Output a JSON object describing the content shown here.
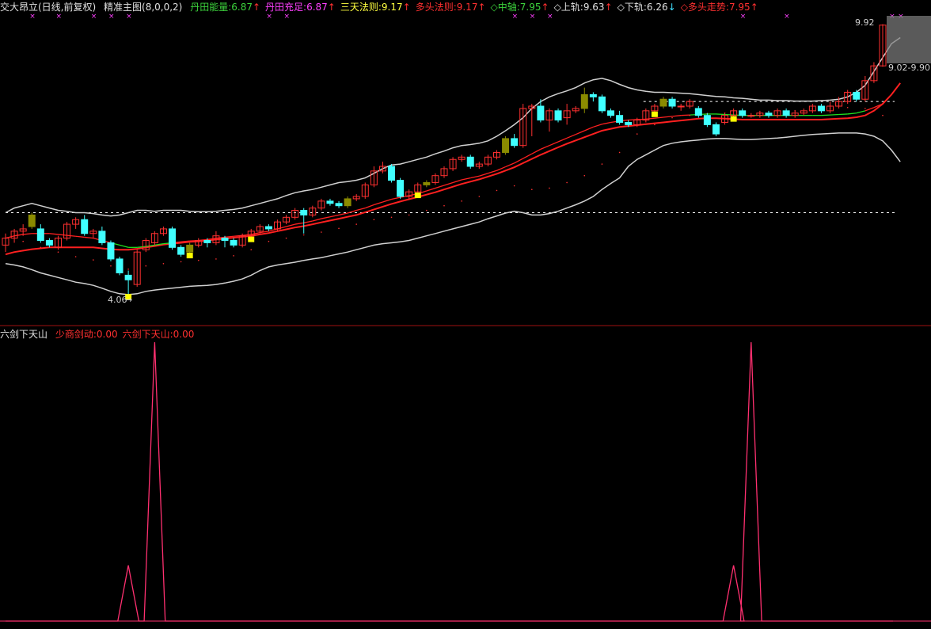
{
  "header": {
    "title": "交大昂立(日线,前复权)",
    "indicator_name": "精准主图(8,0,0,2)",
    "items": [
      {
        "text": "丹田能量:6.87",
        "arrow": "↑",
        "color": "#3cd23c",
        "arrow_color": "#ff3030"
      },
      {
        "text": "丹田充足:6.87",
        "arrow": "↑",
        "color": "#ff40ff",
        "arrow_color": "#ff3030"
      },
      {
        "text": "三天法则:9.17",
        "arrow": "↑",
        "color": "#ffff40",
        "arrow_color": "#ff3030"
      },
      {
        "text": "多头法则:9.17",
        "arrow": "↑",
        "color": "#ff3030",
        "arrow_color": "#ff3030"
      },
      {
        "text": "◇中轴:7.95",
        "arrow": "↑",
        "color": "#3cd23c",
        "arrow_color": "#ff3030"
      },
      {
        "text": "◇上轨:9.63",
        "arrow": "↑",
        "color": "#e0e0e0",
        "arrow_color": "#ff3030"
      },
      {
        "text": "◇下轨:6.26",
        "arrow": "↓",
        "color": "#e0e0e0",
        "arrow_color": "#40e0ff"
      },
      {
        "text": "◇多头走势:7.95",
        "arrow": "↑",
        "color": "#ff3030",
        "arrow_color": "#ff3030"
      }
    ]
  },
  "sub_header": {
    "title": "六剑下天山",
    "items": [
      {
        "text": "少商剑动:0.00",
        "color": "#ff3030"
      },
      {
        "text": "六剑下天山:0.00",
        "color": "#ff3030"
      }
    ]
  },
  "annotations": {
    "high_label": "9.92",
    "low_label": "4.06",
    "range_label": "9.02-9.90"
  },
  "colors": {
    "up": "#ff3030",
    "down": "#40ffff",
    "olive": "#8b8b00",
    "yellow": "#ffff00",
    "upper_band": "#d0d0d0",
    "ma_red": "#ff2020",
    "ma_green": "#20e020",
    "sub_line": "#ff3070",
    "separator": "#a01010"
  },
  "chart_data": {
    "type": "candlestick",
    "title": "交大昂立(日线,前复权)",
    "ylim": [
      3.6,
      10.1
    ],
    "candles": [
      {
        "o": 5.15,
        "c": 5.3,
        "h": 5.4,
        "l": 5.0
      },
      {
        "o": 5.3,
        "c": 5.45,
        "h": 5.5,
        "l": 5.2
      },
      {
        "o": 5.45,
        "c": 5.5,
        "h": 5.6,
        "l": 5.35
      },
      {
        "o": 5.55,
        "c": 5.8,
        "h": 5.85,
        "l": 5.5
      },
      {
        "o": 5.5,
        "c": 5.25,
        "h": 5.6,
        "l": 5.2
      },
      {
        "o": 5.25,
        "c": 5.15,
        "h": 5.3,
        "l": 5.1
      },
      {
        "o": 5.1,
        "c": 5.3,
        "h": 5.35,
        "l": 5.05
      },
      {
        "o": 5.3,
        "c": 5.6,
        "h": 5.65,
        "l": 5.25
      },
      {
        "o": 5.6,
        "c": 5.7,
        "h": 5.75,
        "l": 5.5
      },
      {
        "o": 5.7,
        "c": 5.4,
        "h": 5.8,
        "l": 5.35
      },
      {
        "o": 5.4,
        "c": 5.45,
        "h": 5.5,
        "l": 5.3
      },
      {
        "o": 5.45,
        "c": 5.2,
        "h": 5.55,
        "l": 5.15
      },
      {
        "o": 5.2,
        "c": 4.85,
        "h": 5.25,
        "l": 4.8
      },
      {
        "o": 4.85,
        "c": 4.55,
        "h": 4.9,
        "l": 4.5
      },
      {
        "o": 4.5,
        "c": 4.4,
        "h": 4.6,
        "l": 4.06
      },
      {
        "o": 4.3,
        "c": 5.0,
        "h": 5.05,
        "l": 4.25
      },
      {
        "o": 5.05,
        "c": 5.25,
        "h": 5.3,
        "l": 5.0
      },
      {
        "o": 5.2,
        "c": 5.4,
        "h": 5.45,
        "l": 5.15
      },
      {
        "o": 5.4,
        "c": 5.5,
        "h": 5.55,
        "l": 5.35
      },
      {
        "o": 5.5,
        "c": 5.1,
        "h": 5.55,
        "l": 5.05
      },
      {
        "o": 5.1,
        "c": 4.95,
        "h": 5.15,
        "l": 4.9
      },
      {
        "o": 5.0,
        "c": 5.15,
        "h": 5.2,
        "l": 4.95
      },
      {
        "o": 5.15,
        "c": 5.25,
        "h": 5.3,
        "l": 5.1
      },
      {
        "o": 5.25,
        "c": 5.2,
        "h": 5.3,
        "l": 5.1
      },
      {
        "o": 5.2,
        "c": 5.35,
        "h": 5.45,
        "l": 5.15
      },
      {
        "o": 5.3,
        "c": 5.25,
        "h": 5.35,
        "l": 5.1
      },
      {
        "o": 5.25,
        "c": 5.15,
        "h": 5.3,
        "l": 5.1
      },
      {
        "o": 5.15,
        "c": 5.35,
        "h": 5.4,
        "l": 5.1
      },
      {
        "o": 5.35,
        "c": 5.45,
        "h": 5.5,
        "l": 5.3
      },
      {
        "o": 5.45,
        "c": 5.55,
        "h": 5.6,
        "l": 5.4
      },
      {
        "o": 5.55,
        "c": 5.5,
        "h": 5.6,
        "l": 5.45
      },
      {
        "o": 5.5,
        "c": 5.65,
        "h": 5.7,
        "l": 5.45
      },
      {
        "o": 5.65,
        "c": 5.75,
        "h": 5.8,
        "l": 5.6
      },
      {
        "o": 5.75,
        "c": 5.9,
        "h": 5.95,
        "l": 5.7
      },
      {
        "o": 5.9,
        "c": 5.8,
        "h": 5.95,
        "l": 5.4
      },
      {
        "o": 5.8,
        "c": 5.95,
        "h": 6.0,
        "l": 5.75
      },
      {
        "o": 5.95,
        "c": 6.1,
        "h": 6.15,
        "l": 5.9
      },
      {
        "o": 6.1,
        "c": 6.05,
        "h": 6.15,
        "l": 6.0
      },
      {
        "o": 6.05,
        "c": 6.0,
        "h": 6.1,
        "l": 5.95
      },
      {
        "o": 6.0,
        "c": 6.15,
        "h": 6.2,
        "l": 5.95
      },
      {
        "o": 6.15,
        "c": 6.2,
        "h": 6.25,
        "l": 6.1
      },
      {
        "o": 6.2,
        "c": 6.45,
        "h": 6.5,
        "l": 6.15
      },
      {
        "o": 6.45,
        "c": 6.75,
        "h": 6.85,
        "l": 6.4
      },
      {
        "o": 6.75,
        "c": 6.85,
        "h": 6.95,
        "l": 6.7
      },
      {
        "o": 6.85,
        "c": 6.55,
        "h": 6.9,
        "l": 6.5
      },
      {
        "o": 6.55,
        "c": 6.2,
        "h": 6.6,
        "l": 6.15
      },
      {
        "o": 6.2,
        "c": 6.3,
        "h": 6.35,
        "l": 6.15
      },
      {
        "o": 6.3,
        "c": 6.45,
        "h": 6.5,
        "l": 6.25
      },
      {
        "o": 6.45,
        "c": 6.5,
        "h": 6.55,
        "l": 6.4
      },
      {
        "o": 6.5,
        "c": 6.65,
        "h": 6.7,
        "l": 6.45
      },
      {
        "o": 6.65,
        "c": 6.8,
        "h": 6.85,
        "l": 6.6
      },
      {
        "o": 6.8,
        "c": 7.0,
        "h": 7.05,
        "l": 6.75
      },
      {
        "o": 7.0,
        "c": 7.05,
        "h": 7.1,
        "l": 6.95
      },
      {
        "o": 7.05,
        "c": 6.85,
        "h": 7.1,
        "l": 6.8
      },
      {
        "o": 6.85,
        "c": 6.9,
        "h": 6.95,
        "l": 6.8
      },
      {
        "o": 6.9,
        "c": 7.05,
        "h": 7.1,
        "l": 6.85
      },
      {
        "o": 7.05,
        "c": 7.15,
        "h": 7.2,
        "l": 7.0
      },
      {
        "o": 7.15,
        "c": 7.45,
        "h": 7.5,
        "l": 7.1
      },
      {
        "o": 7.45,
        "c": 7.3,
        "h": 7.55,
        "l": 7.25
      },
      {
        "o": 7.3,
        "c": 8.1,
        "h": 8.2,
        "l": 7.25
      },
      {
        "o": 8.1,
        "c": 8.15,
        "h": 8.2,
        "l": 7.5
      },
      {
        "o": 8.15,
        "c": 7.85,
        "h": 8.3,
        "l": 7.8
      },
      {
        "o": 7.85,
        "c": 8.05,
        "h": 8.1,
        "l": 7.6
      },
      {
        "o": 8.05,
        "c": 7.85,
        "h": 8.1,
        "l": 7.8
      },
      {
        "o": 7.9,
        "c": 8.05,
        "h": 8.2,
        "l": 7.75
      },
      {
        "o": 8.05,
        "c": 8.1,
        "h": 8.15,
        "l": 8.0
      },
      {
        "o": 8.1,
        "c": 8.4,
        "h": 8.55,
        "l": 8.0
      },
      {
        "o": 8.4,
        "c": 8.35,
        "h": 8.45,
        "l": 8.25
      },
      {
        "o": 8.35,
        "c": 8.05,
        "h": 8.4,
        "l": 8.0
      },
      {
        "o": 8.05,
        "c": 7.95,
        "h": 8.1,
        "l": 7.9
      },
      {
        "o": 7.95,
        "c": 7.8,
        "h": 8.05,
        "l": 7.75
      },
      {
        "o": 7.8,
        "c": 7.75,
        "h": 7.85,
        "l": 7.7
      },
      {
        "o": 7.75,
        "c": 7.85,
        "h": 7.9,
        "l": 7.7
      },
      {
        "o": 7.85,
        "c": 8.05,
        "h": 8.1,
        "l": 7.8
      },
      {
        "o": 8.05,
        "c": 8.15,
        "h": 8.2,
        "l": 8.0
      },
      {
        "o": 8.15,
        "c": 8.3,
        "h": 8.35,
        "l": 8.1
      },
      {
        "o": 8.3,
        "c": 8.15,
        "h": 8.35,
        "l": 8.1
      },
      {
        "o": 8.15,
        "c": 8.15,
        "h": 8.2,
        "l": 8.05
      },
      {
        "o": 8.15,
        "c": 8.25,
        "h": 8.3,
        "l": 8.1
      },
      {
        "o": 8.1,
        "c": 7.95,
        "h": 8.15,
        "l": 7.9
      },
      {
        "o": 7.95,
        "c": 7.75,
        "h": 8.0,
        "l": 7.7
      },
      {
        "o": 7.75,
        "c": 7.55,
        "h": 7.8,
        "l": 7.5
      },
      {
        "o": 7.8,
        "c": 7.95,
        "h": 8.0,
        "l": 7.75
      },
      {
        "o": 7.95,
        "c": 8.05,
        "h": 8.1,
        "l": 7.9
      },
      {
        "o": 8.05,
        "c": 7.95,
        "h": 8.1,
        "l": 7.9
      },
      {
        "o": 7.95,
        "c": 7.95,
        "h": 8.0,
        "l": 7.9
      },
      {
        "o": 7.95,
        "c": 8.0,
        "h": 8.05,
        "l": 7.9
      },
      {
        "o": 8.0,
        "c": 7.95,
        "h": 8.05,
        "l": 7.9
      },
      {
        "o": 7.95,
        "c": 8.05,
        "h": 8.1,
        "l": 7.9
      },
      {
        "o": 8.05,
        "c": 7.95,
        "h": 8.1,
        "l": 7.9
      },
      {
        "o": 7.95,
        "c": 8.0,
        "h": 8.05,
        "l": 7.9
      },
      {
        "o": 8.0,
        "c": 8.05,
        "h": 8.1,
        "l": 7.95
      },
      {
        "o": 8.05,
        "c": 8.15,
        "h": 8.2,
        "l": 8.0
      },
      {
        "o": 8.15,
        "c": 8.05,
        "h": 8.2,
        "l": 8.0
      },
      {
        "o": 8.05,
        "c": 8.15,
        "h": 8.25,
        "l": 8.0
      },
      {
        "o": 8.15,
        "c": 8.25,
        "h": 8.35,
        "l": 8.1
      },
      {
        "o": 8.25,
        "c": 8.45,
        "h": 8.5,
        "l": 8.2
      },
      {
        "o": 8.45,
        "c": 8.3,
        "h": 8.5,
        "l": 8.25
      },
      {
        "o": 8.3,
        "c": 8.7,
        "h": 8.8,
        "l": 8.25
      },
      {
        "o": 8.7,
        "c": 9.02,
        "h": 9.1,
        "l": 8.65
      },
      {
        "o": 9.02,
        "c": 9.9,
        "h": 9.92,
        "l": 9.0
      }
    ],
    "mid_band": [
      5.3,
      5.35,
      5.38,
      5.4,
      5.4,
      5.4,
      5.38,
      5.36,
      5.34,
      5.32,
      5.3,
      5.25,
      5.2,
      5.15,
      5.1,
      5.1,
      5.12,
      5.15,
      5.18,
      5.2,
      5.22,
      5.24,
      5.25,
      5.27,
      5.3,
      5.32,
      5.34,
      5.36,
      5.38,
      5.42,
      5.45,
      5.5,
      5.55,
      5.6,
      5.63,
      5.67,
      5.72,
      5.76,
      5.8,
      5.84,
      5.9,
      5.95,
      6.02,
      6.08,
      6.14,
      6.18,
      6.22,
      6.26,
      6.32,
      6.38,
      6.44,
      6.5,
      6.56,
      6.6,
      6.64,
      6.7,
      6.76,
      6.84,
      6.92,
      7.02,
      7.12,
      7.22,
      7.3,
      7.38,
      7.46,
      7.54,
      7.62,
      7.7,
      7.76,
      7.8,
      7.83,
      7.85,
      7.86,
      7.87,
      7.89,
      7.91,
      7.93,
      7.95,
      7.96,
      7.97,
      7.98,
      7.98,
      7.97,
      7.96,
      7.95,
      7.95,
      7.95,
      7.95,
      7.95,
      7.95,
      7.95,
      7.95,
      7.95,
      7.95,
      7.96,
      7.97,
      7.98,
      8.0,
      8.05,
      8.12,
      8.2,
      8.3,
      8.45
    ],
    "upper_band": [
      5.85,
      5.95,
      6.0,
      6.05,
      6.0,
      5.95,
      5.9,
      5.88,
      5.85,
      5.85,
      5.83,
      5.8,
      5.78,
      5.8,
      5.85,
      5.9,
      5.9,
      5.88,
      5.9,
      5.9,
      5.9,
      5.88,
      5.87,
      5.87,
      5.88,
      5.9,
      5.92,
      5.95,
      6.0,
      6.05,
      6.1,
      6.15,
      6.22,
      6.28,
      6.32,
      6.35,
      6.4,
      6.45,
      6.5,
      6.52,
      6.55,
      6.6,
      6.7,
      6.8,
      6.88,
      6.9,
      6.95,
      7.0,
      7.05,
      7.12,
      7.18,
      7.25,
      7.3,
      7.32,
      7.35,
      7.4,
      7.5,
      7.62,
      7.75,
      7.9,
      8.1,
      8.25,
      8.35,
      8.42,
      8.48,
      8.55,
      8.65,
      8.72,
      8.75,
      8.7,
      8.62,
      8.55,
      8.5,
      8.47,
      8.45,
      8.45,
      8.44,
      8.43,
      8.42,
      8.4,
      8.38,
      8.36,
      8.35,
      8.33,
      8.32,
      8.3,
      8.28,
      8.28,
      8.27,
      8.27,
      8.26,
      8.26,
      8.26,
      8.27,
      8.28,
      8.3,
      8.35,
      8.45,
      8.6,
      8.9,
      9.2,
      9.5,
      9.63
    ],
    "lower_band": [
      4.75,
      4.72,
      4.68,
      4.62,
      4.55,
      4.5,
      4.45,
      4.4,
      4.35,
      4.32,
      4.28,
      4.22,
      4.15,
      4.1,
      4.08,
      4.1,
      4.15,
      4.18,
      4.2,
      4.22,
      4.24,
      4.26,
      4.27,
      4.28,
      4.3,
      4.33,
      4.37,
      4.42,
      4.5,
      4.6,
      4.68,
      4.72,
      4.75,
      4.78,
      4.82,
      4.85,
      4.88,
      4.92,
      4.96,
      5.0,
      5.05,
      5.1,
      5.15,
      5.18,
      5.2,
      5.22,
      5.25,
      5.3,
      5.35,
      5.4,
      5.45,
      5.5,
      5.55,
      5.6,
      5.65,
      5.72,
      5.78,
      5.84,
      5.88,
      5.85,
      5.8,
      5.8,
      5.83,
      5.88,
      5.95,
      6.02,
      6.1,
      6.2,
      6.35,
      6.48,
      6.6,
      6.85,
      7.0,
      7.1,
      7.2,
      7.3,
      7.35,
      7.38,
      7.4,
      7.42,
      7.44,
      7.45,
      7.45,
      7.44,
      7.43,
      7.43,
      7.44,
      7.45,
      7.46,
      7.48,
      7.5,
      7.52,
      7.54,
      7.55,
      7.56,
      7.57,
      7.57,
      7.57,
      7.55,
      7.5,
      7.4,
      7.2,
      6.95
    ],
    "ma_trend": [
      4.95,
      5.0,
      5.03,
      5.06,
      5.08,
      5.1,
      5.1,
      5.1,
      5.1,
      5.1,
      5.1,
      5.08,
      5.06,
      5.05,
      5.05,
      5.07,
      5.1,
      5.13,
      5.16,
      5.18,
      5.2,
      5.22,
      5.23,
      5.25,
      5.27,
      5.29,
      5.31,
      5.33,
      5.35,
      5.38,
      5.41,
      5.45,
      5.49,
      5.53,
      5.56,
      5.6,
      5.64,
      5.68,
      5.72,
      5.76,
      5.8,
      5.86,
      5.92,
      5.98,
      6.04,
      6.09,
      6.14,
      6.19,
      6.24,
      6.29,
      6.35,
      6.41,
      6.47,
      6.52,
      6.57,
      6.63,
      6.69,
      6.76,
      6.83,
      6.92,
      7.01,
      7.1,
      7.18,
      7.26,
      7.34,
      7.41,
      7.48,
      7.55,
      7.62,
      7.66,
      7.7,
      7.72,
      7.74,
      7.76,
      7.78,
      7.8,
      7.82,
      7.84,
      7.86,
      7.88,
      7.89,
      7.89,
      7.88,
      7.87,
      7.86,
      7.86,
      7.86,
      7.86,
      7.86,
      7.86,
      7.86,
      7.86,
      7.86,
      7.86,
      7.87,
      7.88,
      7.89,
      7.91,
      7.95,
      8.05,
      8.2,
      8.4,
      8.65
    ],
    "resistance_level": 8.25,
    "support_level": 5.85,
    "indicator": {
      "name": "六剑下天山",
      "series": [
        {
          "name": "少商剑动",
          "values": [
            0.0
          ]
        },
        {
          "name": "六剑下天山",
          "values": [
            0.0
          ]
        }
      ],
      "spike_positions": [
        14,
        17,
        83,
        85
      ],
      "spike_heights": [
        0.2,
        1.0,
        0.2,
        1.0
      ]
    }
  }
}
